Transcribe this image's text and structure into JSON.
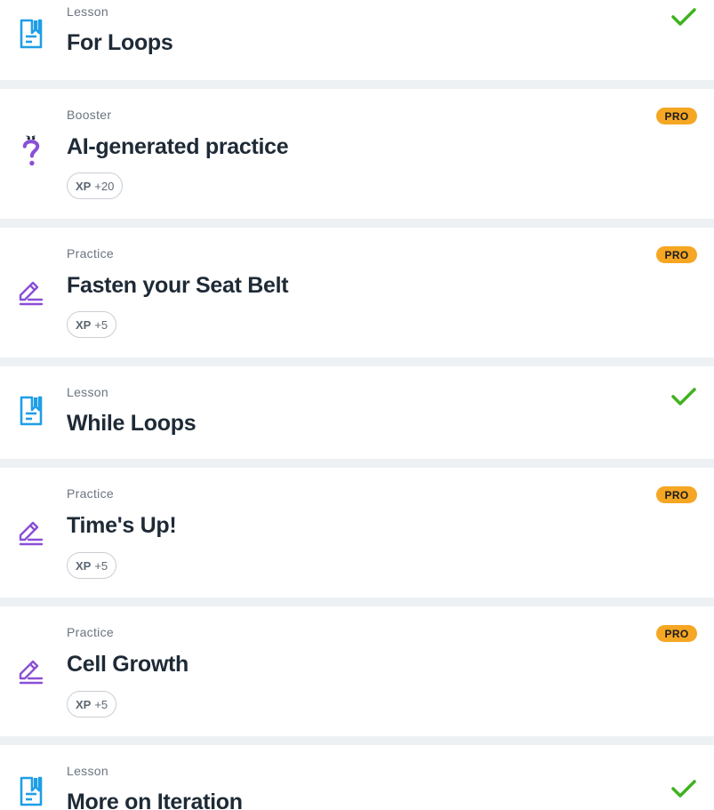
{
  "items": [
    {
      "type_label": "Lesson",
      "title": "For Loops",
      "icon": "lesson-doc-icon",
      "status": "completed"
    },
    {
      "type_label": "Booster",
      "title": "AI-generated practice",
      "icon": "question-mark-icon",
      "badge": "PRO",
      "xp_label": "XP",
      "xp_amount": "+20"
    },
    {
      "type_label": "Practice",
      "title": "Fasten your Seat Belt",
      "icon": "pencil-icon",
      "badge": "PRO",
      "xp_label": "XP",
      "xp_amount": "+5"
    },
    {
      "type_label": "Lesson",
      "title": "While Loops",
      "icon": "lesson-doc-icon",
      "status": "completed"
    },
    {
      "type_label": "Practice",
      "title": "Time's Up!",
      "icon": "pencil-icon",
      "badge": "PRO",
      "xp_label": "XP",
      "xp_amount": "+5"
    },
    {
      "type_label": "Practice",
      "title": "Cell Growth",
      "icon": "pencil-icon",
      "badge": "PRO",
      "xp_label": "XP",
      "xp_amount": "+5"
    },
    {
      "type_label": "Lesson",
      "title": "More on Iteration",
      "icon": "lesson-doc-icon",
      "status": "completed"
    }
  ],
  "colors": {
    "lesson_icon": "#1f9ee6",
    "practice_icon": "#8a4fd6",
    "check": "#3fb21d",
    "pro_badge": "#f5a623",
    "separator": "#eef1f4"
  }
}
